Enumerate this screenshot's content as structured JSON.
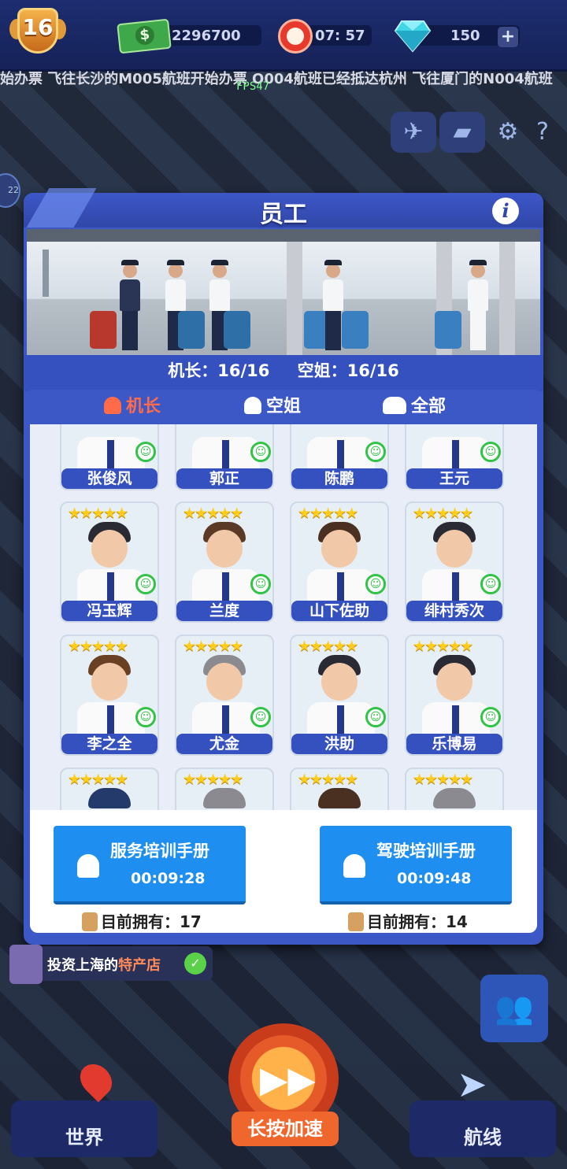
{
  "hud": {
    "level": "16",
    "cash": "2296700",
    "time": "07: 57",
    "gems": "150",
    "plus": "+",
    "ticker": "始办票     飞往长沙的M005航班开始办票   O004航班已经抵达杭州   飞往厦门的N004航班",
    "fps": "FPS47",
    "left_badge": "22"
  },
  "modal": {
    "title": "员工",
    "info": "i",
    "captains_label": "机长：16/16",
    "attendants_label": "空姐：16/16",
    "tabs": [
      {
        "label": "机长"
      },
      {
        "label": "空姐"
      },
      {
        "label": "全部"
      }
    ],
    "stars": "★★★★★",
    "smile": "☺",
    "staff": [
      {
        "name": "张俊风"
      },
      {
        "name": "郭正"
      },
      {
        "name": "陈鹏"
      },
      {
        "name": "王元"
      },
      {
        "name": "冯玉辉"
      },
      {
        "name": "兰度"
      },
      {
        "name": "山下佐助"
      },
      {
        "name": "绯村秀次"
      },
      {
        "name": "李之全"
      },
      {
        "name": "尤金"
      },
      {
        "name": "洪助"
      },
      {
        "name": "乐博易"
      }
    ],
    "service_manual": {
      "title": "服务培训手册",
      "timer": "00:09:28",
      "owned": "目前拥有：17"
    },
    "pilot_manual": {
      "title": "驾驶培训手册",
      "timer": "00:09:48",
      "owned": "目前拥有：14"
    }
  },
  "bottom": {
    "quest_prefix": "投资上海的",
    "quest_highlight": "特产店",
    "world": "世界",
    "speed": "长按加速",
    "routes": "航线"
  },
  "colors": {
    "panel_blue": "#3c58c6",
    "active_tab": "#ff6b48",
    "train_button": "#1e8ff0",
    "star": "#ffcc1a",
    "smile_green": "#32c246"
  }
}
